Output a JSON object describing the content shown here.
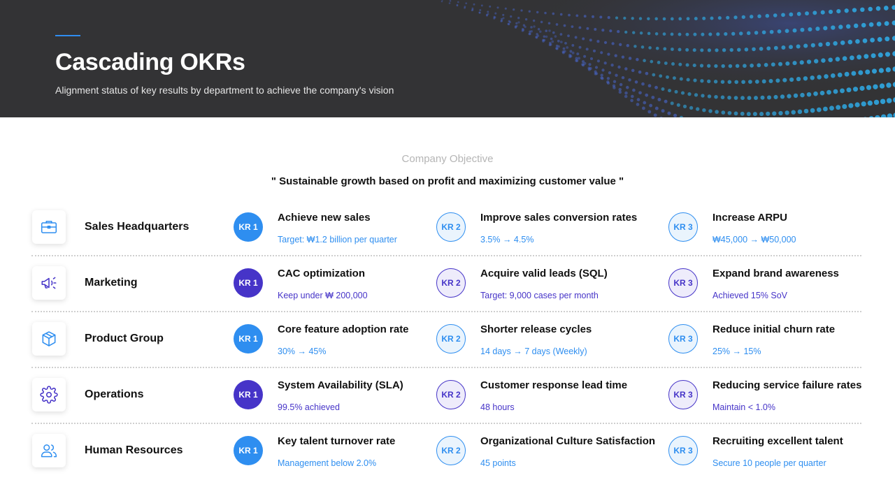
{
  "header": {
    "title": "Cascading OKRs",
    "subtitle": "Alignment status of key results by department to achieve the company's vision"
  },
  "objective": {
    "label": "Company Objective",
    "text": "\" Sustainable growth based on profit and maximizing customer value \""
  },
  "colors": {
    "blue": "#2e8ef0",
    "purple": "#4634c8",
    "banner_bg": "#333335"
  },
  "departments": [
    {
      "name": "Sales Headquarters",
      "icon": "briefcase-icon",
      "theme": "blue",
      "krs": [
        {
          "badge": "KR 1",
          "title": "Achieve new sales",
          "detail": "Target: ₩1.2 billion per quarter"
        },
        {
          "badge": "KR 2",
          "title": "Improve sales conversion rates",
          "detail": "3.5% → 4.5%"
        },
        {
          "badge": "KR 3",
          "title": "Increase ARPU",
          "detail": "₩45,000 → ₩50,000"
        }
      ]
    },
    {
      "name": "Marketing",
      "icon": "megaphone-icon",
      "theme": "purple",
      "krs": [
        {
          "badge": "KR 1",
          "title": "CAC optimization",
          "detail": "Keep under ₩ 200,000"
        },
        {
          "badge": "KR 2",
          "title": "Acquire valid leads (SQL)",
          "detail": "Target: 9,000 cases per month"
        },
        {
          "badge": "KR 3",
          "title": "Expand brand awareness",
          "detail": "Achieved 15% SoV"
        }
      ]
    },
    {
      "name": "Product Group",
      "icon": "box-icon",
      "theme": "blue",
      "krs": [
        {
          "badge": "KR 1",
          "title": "Core feature adoption rate",
          "detail": "30% → 45%"
        },
        {
          "badge": "KR 2",
          "title": "Shorter release cycles",
          "detail": "14 days → 7 days (Weekly)"
        },
        {
          "badge": "KR 3",
          "title": "Reduce initial churn rate",
          "detail": "25% → 15%"
        }
      ]
    },
    {
      "name": "Operations",
      "icon": "gear-icon",
      "theme": "purple",
      "krs": [
        {
          "badge": "KR 1",
          "title": "System Availability (SLA)",
          "detail": "99.5% achieved"
        },
        {
          "badge": "KR 2",
          "title": "Customer response lead time",
          "detail": "48 hours"
        },
        {
          "badge": "KR 3",
          "title": "Reducing service failure rates",
          "detail": "Maintain < 1.0%"
        }
      ]
    },
    {
      "name": "Human Resources",
      "icon": "users-icon",
      "theme": "blue",
      "krs": [
        {
          "badge": "KR 1",
          "title": "Key talent turnover rate",
          "detail": "Management below 2.0%"
        },
        {
          "badge": "KR 2",
          "title": "Organizational Culture Satisfaction",
          "detail": "45 points"
        },
        {
          "badge": "KR 3",
          "title": "Recruiting excellent talent",
          "detail": "Secure 10 people per quarter"
        }
      ]
    }
  ]
}
